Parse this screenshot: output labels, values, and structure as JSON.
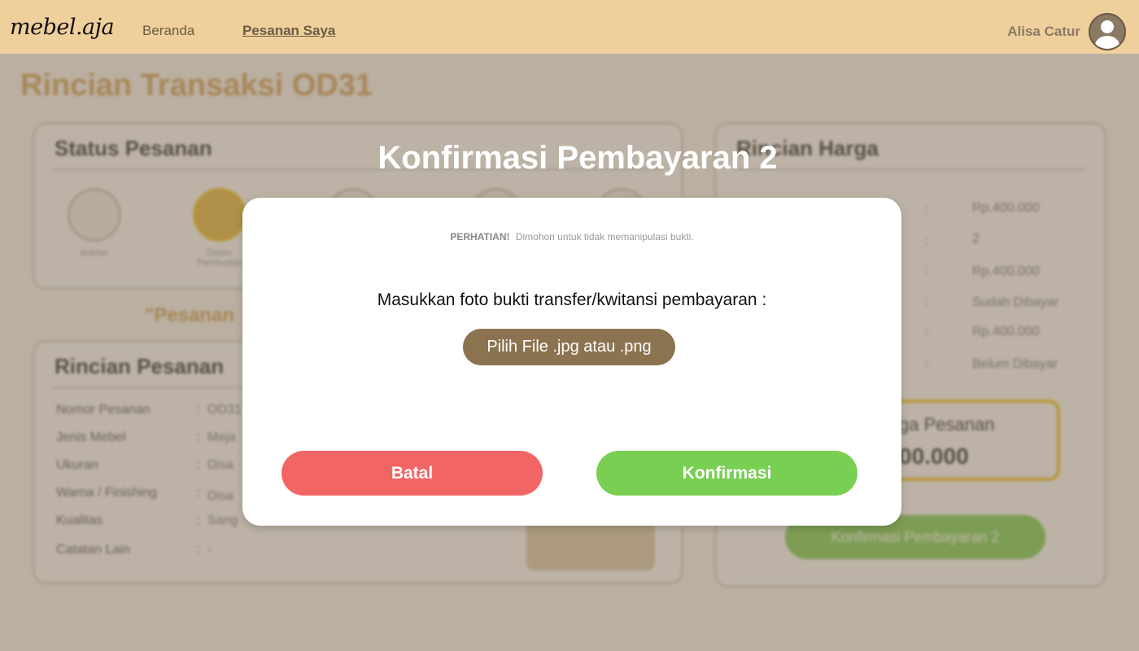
{
  "navbar": {
    "logo": "mebel.aja",
    "links": {
      "home": "Beranda",
      "orders": "Pesanan Saya"
    },
    "user_name": "Alisa Catur",
    "avatar_icon": "user-avatar-icon"
  },
  "background": {
    "page_title": "Rincian Transaksi OD31",
    "status": {
      "heading": "Status Pesanan",
      "steps": [
        {
          "label": "Antrian"
        },
        {
          "label": "Dalam Pembuatan"
        },
        {
          "label": ""
        },
        {
          "label": ""
        },
        {
          "label": ""
        }
      ]
    },
    "note": "\"Pesanan",
    "order_detail": {
      "heading": "Rincian Pesanan",
      "rows": [
        {
          "label": "Nomor Pesanan",
          "value": "OD31"
        },
        {
          "label": "Jenis Mebel",
          "value": "Meja"
        },
        {
          "label": "Ukuran",
          "value": "Disa"
        },
        {
          "label": "Warna / Finishing",
          "value": "Disa"
        },
        {
          "label": "Kualitas",
          "value": "Sang"
        },
        {
          "label": "Catatan Lain",
          "value": "-"
        }
      ]
    },
    "price_detail": {
      "heading": "Rincian Harga",
      "rows": [
        {
          "value": "Rp.400.000"
        },
        {
          "value": "2"
        },
        {
          "value": "Rp.400.000"
        },
        {
          "value": "Sudah Dibayar"
        },
        {
          "value": "Rp.400.000"
        },
        {
          "value": "Belum Dibayar"
        }
      ],
      "total_label": "ga Pesanan",
      "total_value": "00.000",
      "confirm_button": "Konfirmasi Pembayaran 2"
    }
  },
  "modal": {
    "title": "Konfirmasi Pembayaran 2",
    "warning_strong": "PERHATIAN!",
    "warning_text": "Dimohon untuk tidak memanipulasi bukti.",
    "instruction": "Masukkan foto bukti transfer/kwitansi pembayaran :",
    "file_button": "Pilih File .jpg atau .png",
    "cancel_button": "Batal",
    "confirm_button": "Konfirmasi"
  },
  "colors": {
    "navbar": "#efcf9c",
    "file_button": "#8b7350",
    "cancel": "#f26565",
    "confirm": "#79cf52"
  }
}
